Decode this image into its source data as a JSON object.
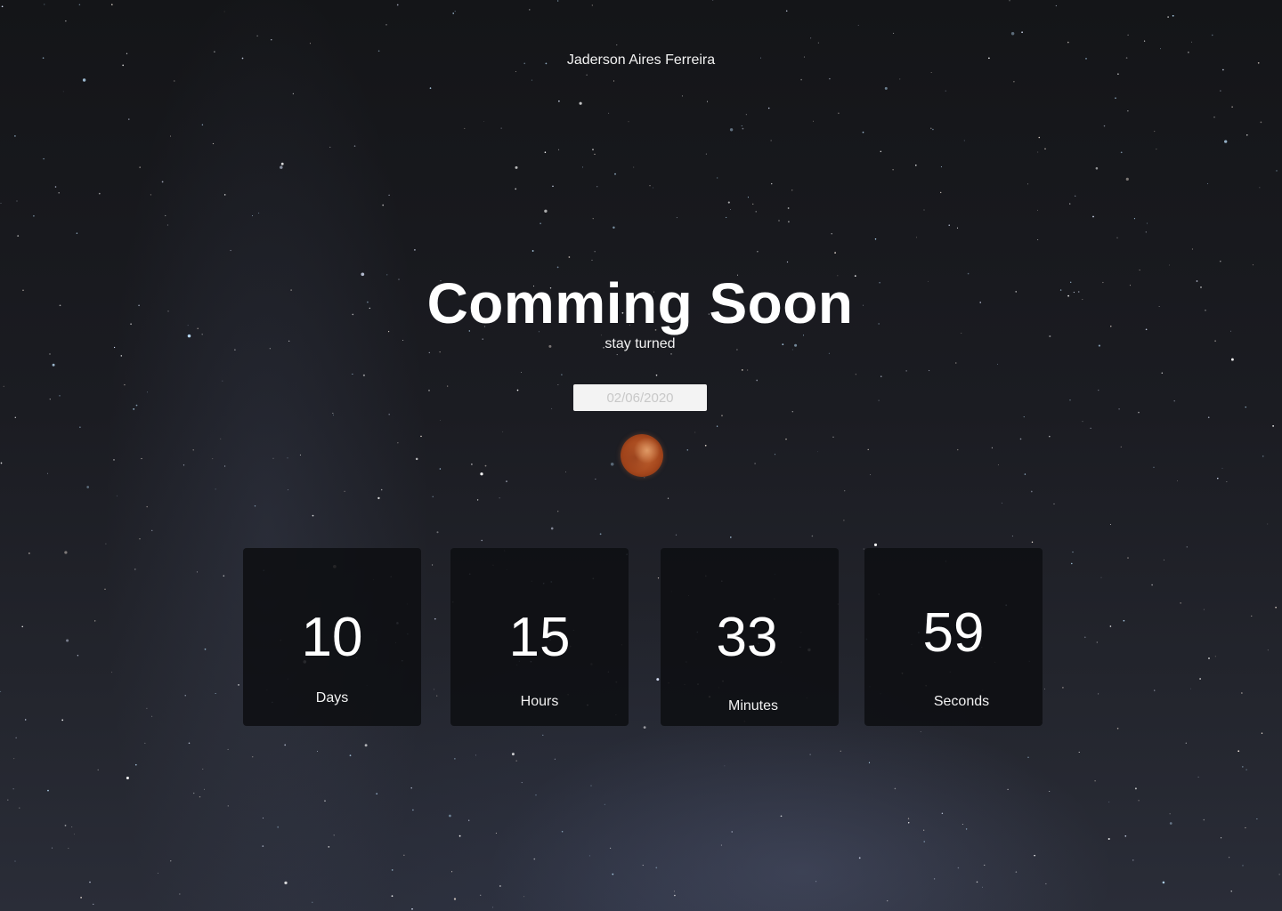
{
  "header": {
    "author": "Jaderson Aires Ferreira"
  },
  "hero": {
    "title": "Comming Soon",
    "subtitle": "stay turned"
  },
  "date_picker": {
    "value": "02/06/2020"
  },
  "countdown": {
    "days": {
      "value": "10",
      "label": "Days"
    },
    "hours": {
      "value": "15",
      "label": "Hours"
    },
    "minutes": {
      "value": "33",
      "label": "Minutes"
    },
    "seconds": {
      "value": "59",
      "label": "Seconds"
    }
  },
  "colors": {
    "background": "#17181c",
    "card": "#0e0f12",
    "text": "#ffffff",
    "moon": "#b3531f",
    "input_bg": "#f3f3f3",
    "input_text": "#c8c8c8"
  }
}
